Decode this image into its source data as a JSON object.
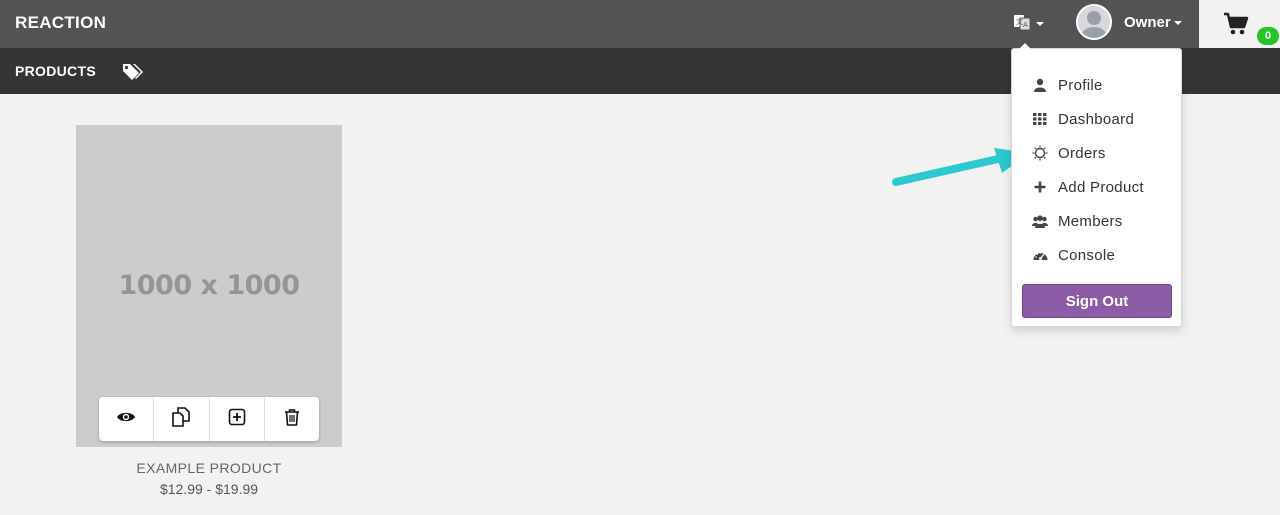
{
  "header": {
    "brand": "REACTION",
    "language_icon": "translate-icon",
    "user_name": "Owner",
    "cart_count": "0"
  },
  "subnav": {
    "products_label": "PRODUCTS",
    "tags_icon": "tags-icon"
  },
  "product": {
    "placeholder": "1000 x 1000",
    "name": "EXAMPLE PRODUCT",
    "price": "$12.99 - $19.99",
    "actions": [
      "eye-icon",
      "duplicate-icon",
      "add-square-icon",
      "trash-icon"
    ]
  },
  "user_menu": {
    "items": [
      {
        "label": "Profile",
        "icon": "user-icon"
      },
      {
        "label": "Dashboard",
        "icon": "grid-icon"
      },
      {
        "label": "Orders",
        "icon": "sun-icon"
      },
      {
        "label": "Add Product",
        "icon": "plus-icon"
      },
      {
        "label": "Members",
        "icon": "users-icon"
      },
      {
        "label": "Console",
        "icon": "dashboard-icon"
      }
    ],
    "sign_out": "Sign Out"
  },
  "colors": {
    "topbar": "#535353",
    "subbar": "#353535",
    "accent_purple": "#8b5ba6",
    "badge_green": "#27c227",
    "annotation_arrow": "#2cc9cf"
  }
}
